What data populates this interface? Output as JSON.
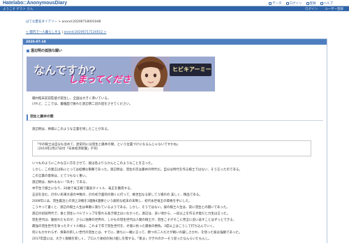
{
  "header": {
    "logo": "Hatelabo::AnonymousDiary",
    "links": [
      {
        "label": "データ"
      },
      {
        "label": "ログイン"
      },
      {
        "label": "登録"
      },
      {
        "label": "ヘルプ"
      }
    ]
  },
  "subheader": {
    "user": "ようこそ ゲスト さん",
    "links": [
      {
        "label": "ログイン"
      },
      {
        "label": "ユーザー登録"
      }
    ]
  },
  "breadcrumb": {
    "site": "はてな匿名ダイアリー",
    "sep": " > ",
    "current": "anond:20200718001048"
  },
  "pager": {
    "prev": "< 都内で一人暮らしする",
    "sep": " | ",
    "next": "anond:20200717124012 >"
  },
  "day": {
    "date": "2020-07-18",
    "title": "遠辺明の孤独な闘い",
    "banner": {
      "line1": "なんですか?",
      "line2": "しまってください",
      "line3": "...",
      "logo": "ヒビキアーミー"
    },
    "intro": [
      "蔵村拓未前前監督が誕生し、全国は大きく沸いている。",
      "けれど、ここでは、書籍面で敗れた渡辺明二冠の話をさせてください。"
    ],
    "section_title": "羽生と藤井の間",
    "section_lead": "渡辺明は、将棋にこのような言葉を残したことがある。",
    "quote": [
      "「今の棋士は自分も含めて、歴史的には羽生と藤井の間、という位置づけになるんじゃないですかね」",
      "（2019年2月27日付「日本経済新聞」夕刊）"
    ],
    "body": [
      "いつものようにこれな言い方をさせて、彼は急ぶりらかんとこのようなことを言った。",
      "しかし、この発言は私にとっては結構な衝撃であった。渡辺明は、羽生の次は藤井の時代だ。自分は時代を作る棋士ではない、そう言ったのである。",
      "この言葉の意味は、とてつもなく重い。",
      "渡辺明は、紛れもない「天才」である。",
      "中学生で棋士になり、20歳で竜王戦で最高タイトル、竜王を獲得する。",
      "五冠を含む、計のい形来大道の中数の、計の初き面的の期くに打って、嫉世出なる新してう場のの 美しく、精品である。",
      "2008年には、羽生義治との頂上決戦を3連敗4連勝という劇的な結末の末制し、初代永世竜王の資格を手にした。",
      "こうやって書くと、渡辺の棋士人生は華奢に満ちているようである。しかし、そうではない。彼の棋士人生は、常に羽生との闘いであった。",
      "渡辺の初段時代で、後と羽生レベルでトップを張れる長き棋士はいなかった。渡辺は、多い頃から、一段以上を作る才能だと力生は言った。",
      "羽生世代は、脇拾れたものが、さらに独尊の世界の、しかもの羽生世代は人間の棋士が、羽生こそがそこに完全に追い返すことはずっとできる。",
      "最強の羽生世代を争ったタイトル戦は、これまで年で羽生世代を、才能に抗った最後の勝負。3度以上はこうして打ち込んでいく。",
      "何にもかかわらず、将来の新しい世代の羽生とは、すでに、勝ちに一緒に言って、勝つの二人だけが戦いの厳しさかわ、を悟った彼は強敵であった。",
      "2017年度には、大きく棋戦を新しく、プロ入り後初の負け越しを喫する。「家ま」がきれのか一そう思ったなんらいたもんし。"
    ]
  }
}
